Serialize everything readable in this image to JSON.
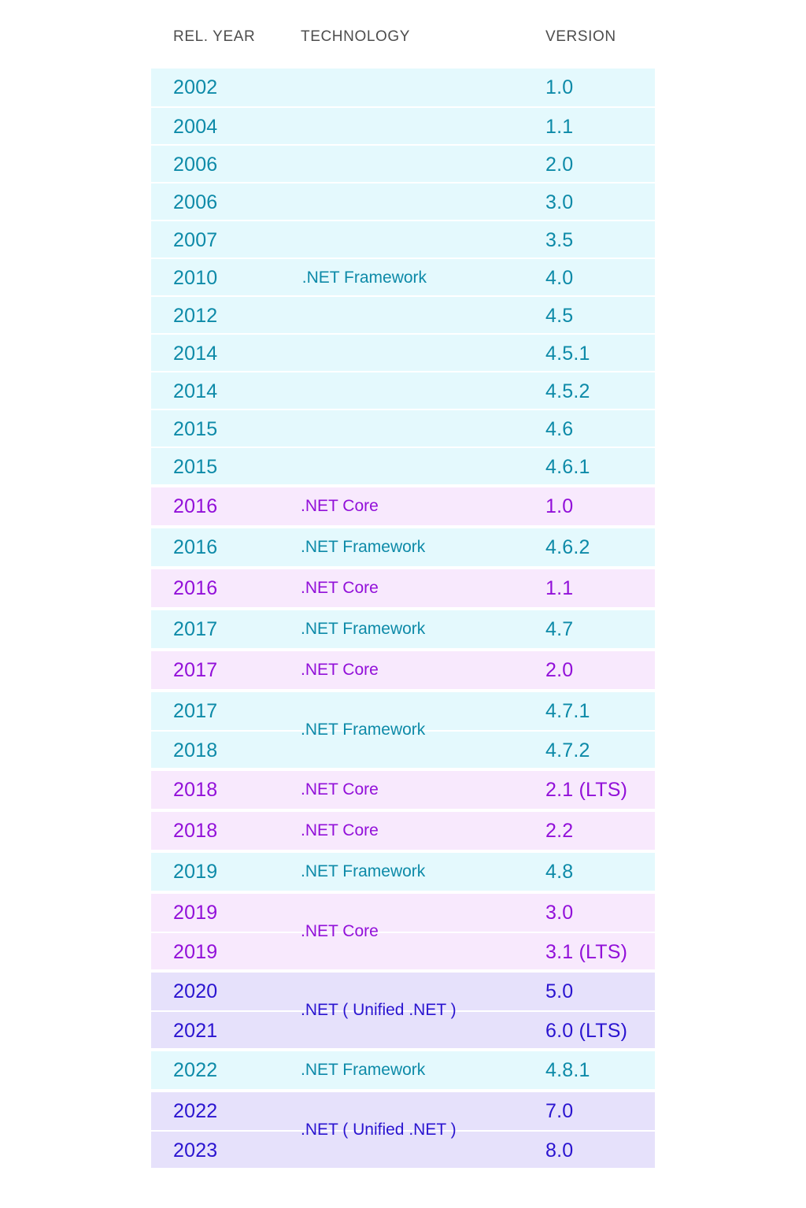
{
  "table": {
    "headers": {
      "year": "REL. YEAR",
      "technology": "TECHNOLOGY",
      "version": "VERSION"
    },
    "colors": {
      "framework_bg": "#e4f9fd",
      "framework_text": "#0d8aa8",
      "core_bg": "#f8e9fd",
      "core_text": "#9210d9",
      "unified_bg": "#e6e1fb",
      "unified_text": "#2a14d0",
      "header_text": "#4d4d4d",
      "page_bg": "#ffffff"
    },
    "groups": [
      {
        "theme": "cyan",
        "technology": " .NET Framework",
        "tech_row_index": 5,
        "rows": [
          {
            "year": "2002",
            "version": "1.0"
          },
          {
            "year": "2004",
            "version": "1.1"
          },
          {
            "year": "2006",
            "version": "2.0"
          },
          {
            "year": "2006",
            "version": "3.0"
          },
          {
            "year": "2007",
            "version": "3.5"
          },
          {
            "year": "2010",
            "version": "4.0"
          },
          {
            "year": "2012",
            "version": "4.5"
          },
          {
            "year": "2014",
            "version": "4.5.1"
          },
          {
            "year": "2014",
            "version": "4.5.2"
          },
          {
            "year": "2015",
            "version": "4.6"
          },
          {
            "year": "2015",
            "version": "4.6.1"
          }
        ]
      },
      {
        "theme": "purple",
        "technology": ".NET Core",
        "tech_row_index": 0,
        "rows": [
          {
            "year": "2016",
            "version": "1.0"
          }
        ]
      },
      {
        "theme": "cyan",
        "technology": ".NET Framework",
        "tech_row_index": 0,
        "rows": [
          {
            "year": "2016",
            "version": "4.6.2"
          }
        ]
      },
      {
        "theme": "purple",
        "technology": ".NET Core",
        "tech_row_index": 0,
        "rows": [
          {
            "year": "2016",
            "version": "1.1"
          }
        ]
      },
      {
        "theme": "cyan",
        "technology": ".NET Framework",
        "tech_row_index": 0,
        "rows": [
          {
            "year": "2017",
            "version": "4.7"
          }
        ]
      },
      {
        "theme": "purple",
        "technology": ".NET Core",
        "tech_row_index": 0,
        "rows": [
          {
            "year": "2017",
            "version": "2.0"
          }
        ]
      },
      {
        "theme": "cyan",
        "technology": ".NET Framework",
        "tech_row_index": null,
        "rows": [
          {
            "year": "2017",
            "version": "4.7.1"
          },
          {
            "year": "2018",
            "version": "4.7.2"
          }
        ]
      },
      {
        "theme": "purple",
        "technology": ".NET Core",
        "tech_row_index": 0,
        "rows": [
          {
            "year": "2018",
            "version": "2.1 (LTS)"
          }
        ]
      },
      {
        "theme": "purple",
        "technology": ".NET Core",
        "tech_row_index": 0,
        "rows": [
          {
            "year": "2018",
            "version": "2.2"
          }
        ]
      },
      {
        "theme": "cyan",
        "technology": ".NET Framework",
        "tech_row_index": 0,
        "rows": [
          {
            "year": "2019",
            "version": "4.8"
          }
        ]
      },
      {
        "theme": "purple",
        "technology": ".NET Core",
        "tech_row_index": null,
        "rows": [
          {
            "year": "2019",
            "version": "3.0"
          },
          {
            "year": "2019",
            "version": "3.1 (LTS)"
          }
        ]
      },
      {
        "theme": "lavender",
        "technology": ".NET ( Unified .NET )",
        "tech_row_index": null,
        "rows": [
          {
            "year": "2020",
            "version": "5.0"
          },
          {
            "year": "2021",
            "version": "6.0 (LTS)"
          }
        ]
      },
      {
        "theme": "cyan",
        "technology": ".NET Framework",
        "tech_row_index": 0,
        "rows": [
          {
            "year": "2022",
            "version": "4.8.1"
          }
        ]
      },
      {
        "theme": "lavender",
        "technology": ".NET ( Unified .NET )",
        "tech_row_index": null,
        "rows": [
          {
            "year": "2022",
            "version": "7.0"
          },
          {
            "year": "2023",
            "version": "8.0"
          }
        ]
      }
    ]
  }
}
